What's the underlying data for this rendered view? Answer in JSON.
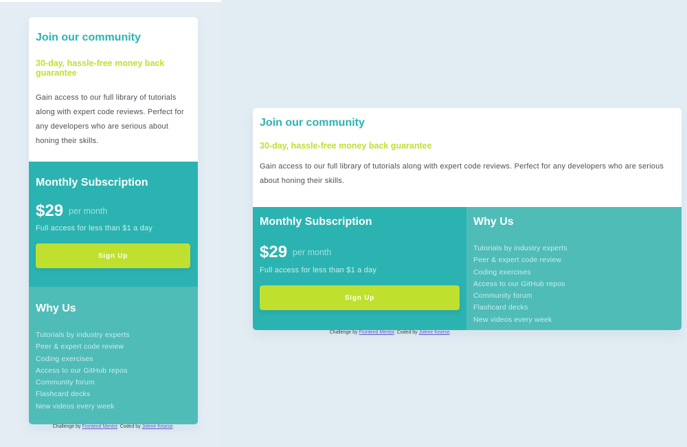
{
  "card": {
    "title": "Join our community",
    "guarantee": "30-day, hassle-free money back guarantee",
    "description": "Gain access to our full library of tutorials along with expert code reviews. Perfect for any developers who are serious about honing their skills.",
    "subscription": {
      "title": "Monthly Subscription",
      "price": "$29",
      "per": "per month",
      "note": "Full access for less than $1 a day",
      "button": "Sign Up"
    },
    "why": {
      "title": "Why Us",
      "items": [
        "Tutorials by industry experts",
        "Peer & expert code review",
        "Coding exercises",
        "Access to our GitHub repos",
        "Community forum",
        "Flashcard decks",
        "New videos every week"
      ]
    }
  },
  "attribution": {
    "prefix": "Challenge by",
    "link1": "Frontend Mentor",
    "middle": ". Coded by",
    "link2": "Jolene Kearse",
    "suffix": "."
  },
  "colors": {
    "accent": "#2bb3b1",
    "lime": "#bfe02f",
    "why_bg": "#4fbcb8",
    "page_bg": "#e2ecf3"
  }
}
